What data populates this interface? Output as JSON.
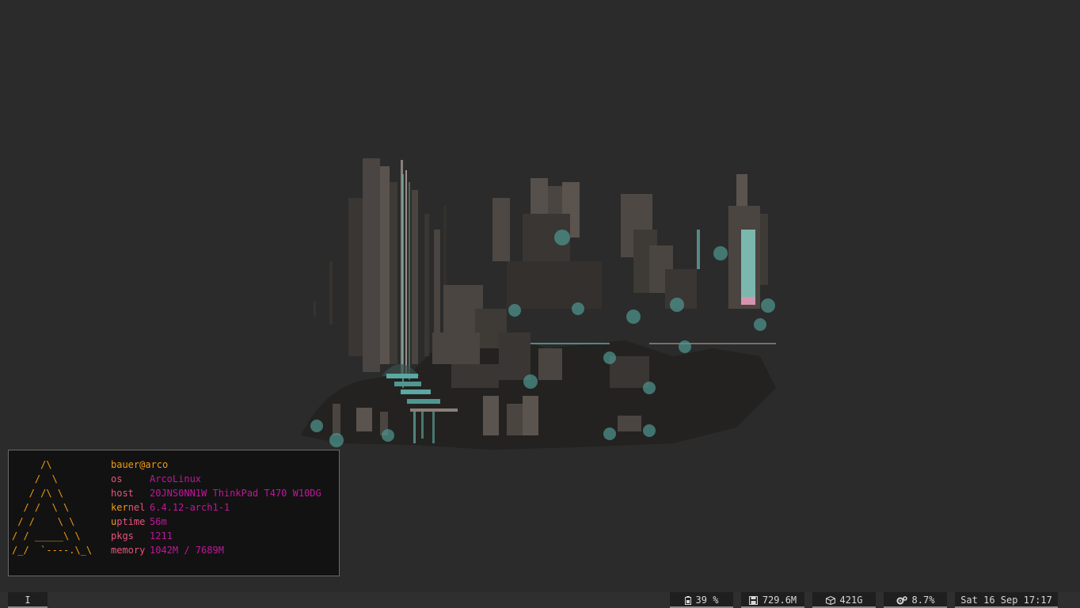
{
  "terminal": {
    "logo": "     /\\\n    /  \\\n   / /\\ \\\n  / /  \\ \\\n / /    \\ \\\n/ / _____\\ \\\n/_/  `----.\\_\\",
    "userhost": "bauer@arco",
    "rows": [
      {
        "key": "os",
        "value": "ArcoLinux"
      },
      {
        "key": "host",
        "value": "20JNS0NN1W ThinkPad T470 W10DG"
      },
      {
        "key_head": "ker",
        "key_tail": "nel",
        "value": "6.4.12-arch1-1"
      },
      {
        "key_head": "u",
        "key_tail": "ptime",
        "value": "56m"
      },
      {
        "key": "pkgs",
        "value": "1211"
      },
      {
        "key": "memory",
        "value": "1042M / 7689M"
      }
    ]
  },
  "statusbar": {
    "workspace": "I",
    "battery": {
      "icon": "battery-icon",
      "value": "39 %"
    },
    "memory": {
      "icon": "save-disk-icon",
      "value": "729.6M"
    },
    "disk": {
      "icon": "package-box-icon",
      "value": "421G"
    },
    "cpu": {
      "icon": "gears-icon",
      "value": "8.7%"
    },
    "clock": "Sat 16 Sep 17:17"
  },
  "colors": {
    "background": "#2b2b2b",
    "terminal_bg": "#121212",
    "logo": "#f39c12",
    "key": "#e8547e",
    "value": "#c0179a",
    "teal": "#6fc9c1"
  }
}
